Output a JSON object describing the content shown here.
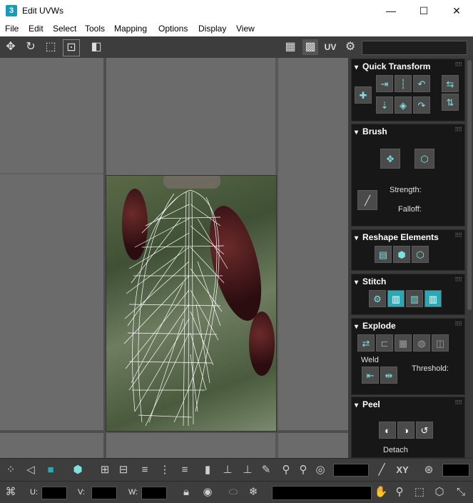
{
  "window": {
    "title": "Edit UVWs",
    "app_icon_glyph": "3",
    "minimize": "—",
    "maximize": "☐",
    "close": "✕"
  },
  "menu": [
    "File",
    "Edit",
    "Select",
    "Tools",
    "Mapping",
    "Options",
    "Display",
    "View"
  ],
  "toolbar": {
    "uv_label": "UV"
  },
  "panels": {
    "quick_transform": {
      "title": "Quick Transform"
    },
    "brush": {
      "title": "Brush",
      "strength_label": "Strength:",
      "falloff_label": "Falloff:"
    },
    "reshape": {
      "title": "Reshape Elements"
    },
    "stitch": {
      "title": "Stitch"
    },
    "explode": {
      "title": "Explode",
      "weld_label": "Weld",
      "threshold_label": "Threshold:"
    },
    "peel": {
      "title": "Peel",
      "detach_label": "Detach"
    }
  },
  "bottom": {
    "xy_label": "XY",
    "u_label": "U:",
    "v_label": "V:",
    "w_label": "W:"
  },
  "colors": {
    "accent": "#2aa9b4",
    "panel_bg": "#171717",
    "viewport_bg": "#6b6b6b"
  }
}
